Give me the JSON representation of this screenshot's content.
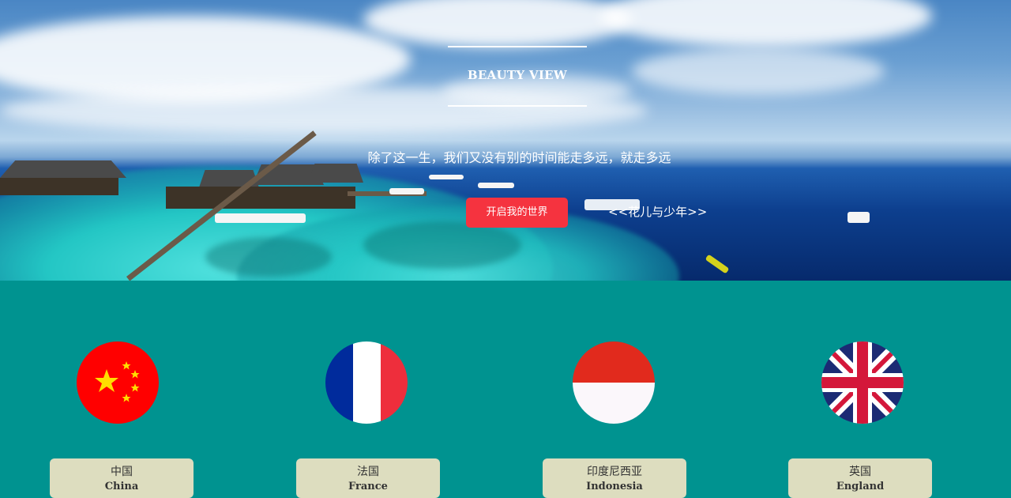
{
  "hero": {
    "title": "BEAUTY VIEW",
    "subtitle": "除了这一生，我们又没有别的时间能走多远，就走多远",
    "cta_label": "开启我的世界",
    "story_link": "<<花儿与少年>>"
  },
  "countries": [
    {
      "name_cn": "中国",
      "name_en": "China",
      "flag_icon": "china-flag-icon"
    },
    {
      "name_cn": "法国",
      "name_en": "France",
      "flag_icon": "france-flag-icon"
    },
    {
      "name_cn": "印度尼西亚",
      "name_en": "Indonesia",
      "flag_icon": "indonesia-flag-icon"
    },
    {
      "name_cn": "英国",
      "name_en": "England",
      "flag_icon": "uk-flag-icon"
    }
  ],
  "colors": {
    "section_background": "#009390",
    "cta_button": "#f5333f",
    "card_background": "#ddddbf"
  }
}
